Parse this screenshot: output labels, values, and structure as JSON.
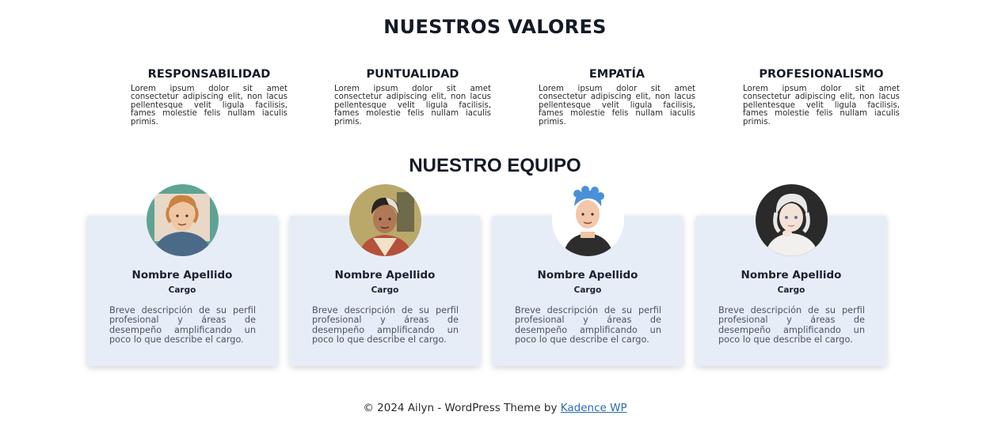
{
  "values": {
    "title": "NUESTROS VALORES",
    "items": [
      {
        "heading": "RESPONSABILIDAD",
        "text": "Lorem ipsum dolor sit amet consectetur adipiscing elit, non lacus pellentesque velit ligula facilisis, fames molestie felis nullam iaculis primis."
      },
      {
        "heading": "PUNTUALIDAD",
        "text": "Lorem ipsum dolor sit amet consectetur adipiscing elit, non lacus pellentesque velit ligula facilisis, fames molestie felis nullam iaculis primis."
      },
      {
        "heading": "EMPATÍA",
        "text": "Lorem ipsum dolor sit amet consectetur adipiscing elit, non lacus pellentesque velit ligula facilisis, fames molestie felis nullam iaculis primis."
      },
      {
        "heading": "PROFESIONALISMO",
        "text": "Lorem ipsum dolor sit amet consectetur adipiscing elit, non lacus pellentesque velit ligula facilisis, fames molestie felis nullam iaculis primis."
      }
    ]
  },
  "team": {
    "title": "NUESTRO EQUIPO",
    "members": [
      {
        "name": "Nombre Apellido",
        "role": "Cargo",
        "description": "Breve descripción de su perfil profesional y áreas de desempeño amplificando un poco lo que describe el cargo.",
        "avatar_icon": "avatar-illustration-ginger-hoodie",
        "avatar_bg": "#5fa393"
      },
      {
        "name": "Nombre Apellido",
        "role": "Cargo",
        "description": "Breve descripción de su perfil profesional y áreas de desempeño amplificando un poco lo que describe el cargo.",
        "avatar_icon": "avatar-illustration-two-tone-hair",
        "avatar_bg": "#b9a86a"
      },
      {
        "name": "Nombre Apellido",
        "role": "Cargo",
        "description": "Breve descripción de su perfil profesional y áreas de desempeño amplificando un poco lo que describe el cargo.",
        "avatar_icon": "avatar-illustration-blue-hair",
        "avatar_bg": "#ffffff"
      },
      {
        "name": "Nombre Apellido",
        "role": "Cargo",
        "description": "Breve descripción de su perfil profesional y áreas de desempeño amplificando un poco lo que describe el cargo.",
        "avatar_icon": "avatar-illustration-white-hair",
        "avatar_bg": "#2a2a2a"
      }
    ]
  },
  "footer": {
    "text": "© 2024 Ailyn - WordPress Theme by ",
    "link_label": "Kadence WP",
    "link_color": "#2b6cb0"
  },
  "colors": {
    "card_bg": "#e7edf7",
    "heading": "#141a26"
  }
}
